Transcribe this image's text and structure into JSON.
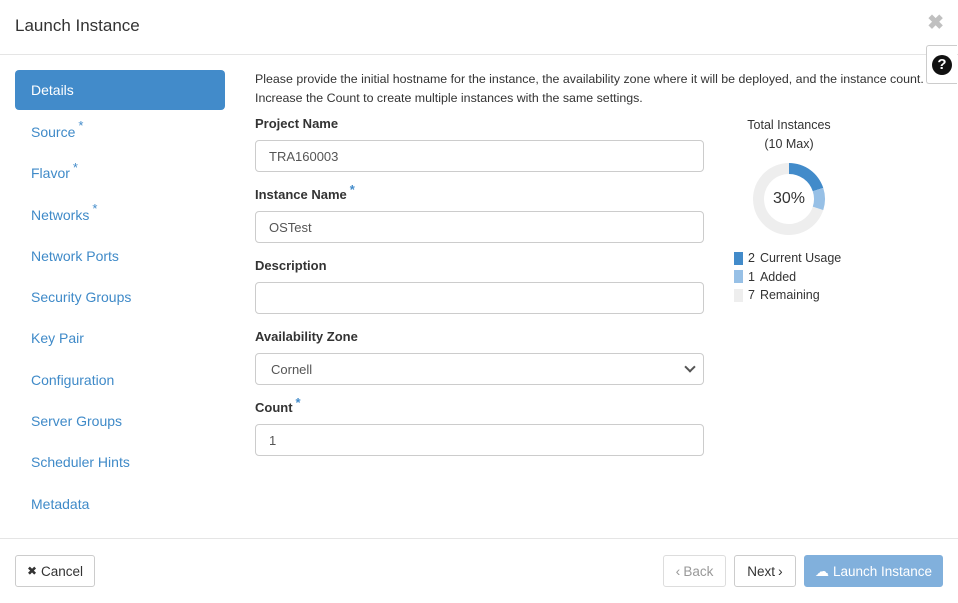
{
  "modal": {
    "title": "Launch Instance",
    "close_icon": "✖",
    "help_icon": "?"
  },
  "nav": {
    "items": [
      {
        "label": "Details",
        "required": false,
        "active": true
      },
      {
        "label": "Source",
        "required": true,
        "active": false
      },
      {
        "label": "Flavor",
        "required": true,
        "active": false
      },
      {
        "label": "Networks",
        "required": true,
        "active": false
      },
      {
        "label": "Network Ports",
        "required": false,
        "active": false
      },
      {
        "label": "Security Groups",
        "required": false,
        "active": false
      },
      {
        "label": "Key Pair",
        "required": false,
        "active": false
      },
      {
        "label": "Configuration",
        "required": false,
        "active": false
      },
      {
        "label": "Server Groups",
        "required": false,
        "active": false
      },
      {
        "label": "Scheduler Hints",
        "required": false,
        "active": false
      },
      {
        "label": "Metadata",
        "required": false,
        "active": false
      }
    ],
    "required_mark": "*"
  },
  "intro": "Please provide the initial hostname for the instance, the availability zone where it will be deployed, and the instance count. Increase the Count to create multiple instances with the same settings.",
  "form": {
    "project_name": {
      "label": "Project Name",
      "value": "TRA160003"
    },
    "instance_name": {
      "label": "Instance Name",
      "required": "*",
      "value": "OSTest"
    },
    "description": {
      "label": "Description",
      "value": ""
    },
    "availability_zone": {
      "label": "Availability Zone",
      "selected": "Cornell"
    },
    "count": {
      "label": "Count",
      "required": "*",
      "value": "1"
    }
  },
  "chart_data": {
    "type": "pie",
    "title": "Total Instances",
    "subtitle": "(10 Max)",
    "center_label": "30%",
    "max": 10,
    "series": [
      {
        "name": "Current Usage",
        "value": 2,
        "color": "#428bca"
      },
      {
        "name": "Added",
        "value": 1,
        "color": "#97c0e6"
      },
      {
        "name": "Remaining",
        "value": 7,
        "color": "#eeeeee"
      }
    ]
  },
  "footer": {
    "cancel": "Cancel",
    "cancel_icon": "✖",
    "back": "Back",
    "back_icon": "‹",
    "next": "Next",
    "next_icon": "›",
    "launch": "Launch Instance",
    "launch_icon": "☁"
  }
}
